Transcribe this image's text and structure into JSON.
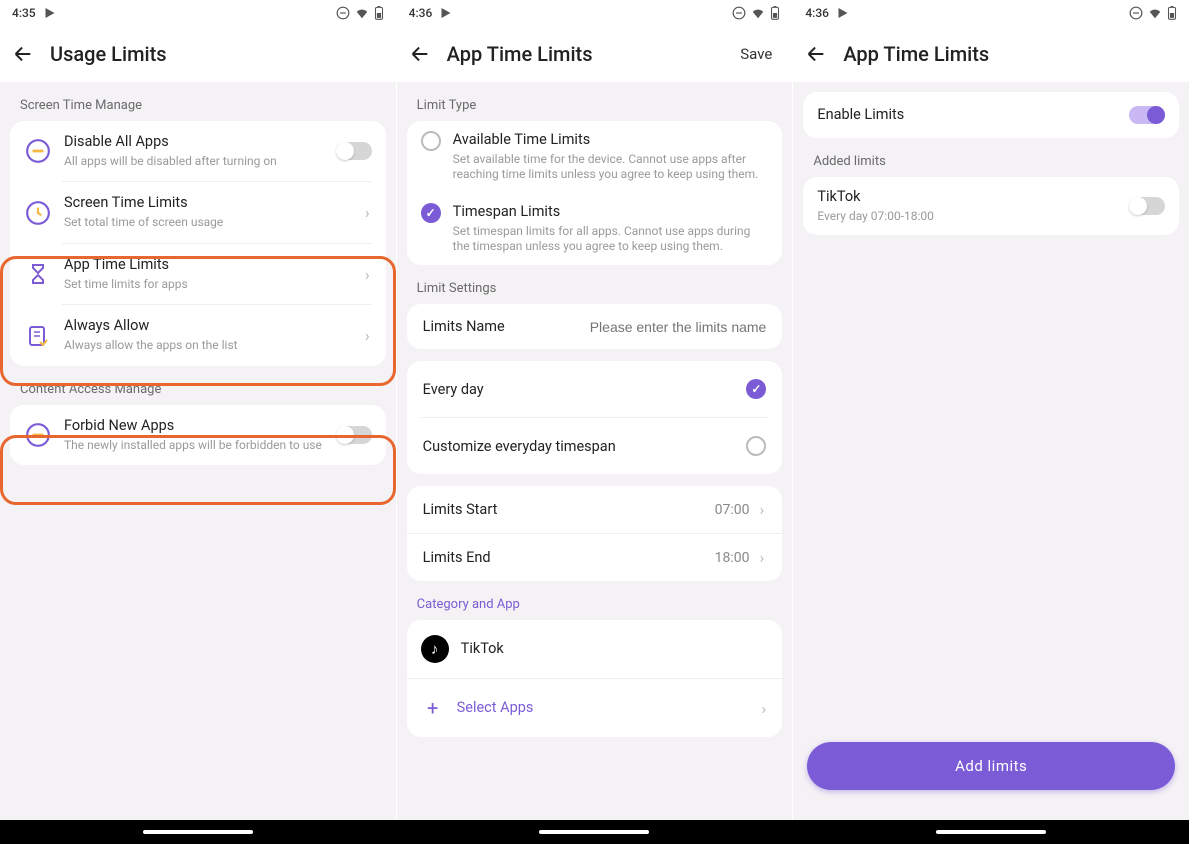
{
  "screen1": {
    "time": "4:35",
    "title": "Usage Limits",
    "section1": "Screen Time Manage",
    "disable_all": {
      "title": "Disable All Apps",
      "sub": "All apps will be disabled after turning on"
    },
    "screen_time": {
      "title": "Screen Time Limits",
      "sub": "Set total time of screen usage"
    },
    "app_time": {
      "title": "App Time Limits",
      "sub": "Set time limits for apps"
    },
    "always_allow": {
      "title": "Always Allow",
      "sub": "Always allow the apps on the list"
    },
    "section2": "Content Access Manage",
    "forbid_new": {
      "title": "Forbid New Apps",
      "sub": "The newly installed apps will be forbidden to use"
    }
  },
  "screen2": {
    "time": "4:36",
    "title": "App Time Limits",
    "save": "Save",
    "limit_type_label": "Limit Type",
    "available": {
      "title": "Available Time Limits",
      "sub": "Set available time for the device. Cannot use apps after reaching time limits unless you agree to keep using them."
    },
    "timespan": {
      "title": "Timespan Limits",
      "sub": "Set timespan limits for all apps. Cannot use apps during the timespan unless you agree to keep using them."
    },
    "limit_settings_label": "Limit Settings",
    "limits_name_label": "Limits Name",
    "limits_name_placeholder": "Please enter the limits name",
    "every_day": "Every day",
    "customize": "Customize everyday timespan",
    "start_label": "Limits Start",
    "start_value": "07:00",
    "end_label": "Limits End",
    "end_value": "18:00",
    "category_label": "Category and App",
    "app_name": "TikTok",
    "select_apps": "Select Apps"
  },
  "screen3": {
    "time": "4:36",
    "title": "App Time Limits",
    "enable_label": "Enable Limits",
    "added_label": "Added limits",
    "limit": {
      "title": "TikTok",
      "sub": "Every day 07:00-18:00"
    },
    "add_button": "Add limits"
  }
}
